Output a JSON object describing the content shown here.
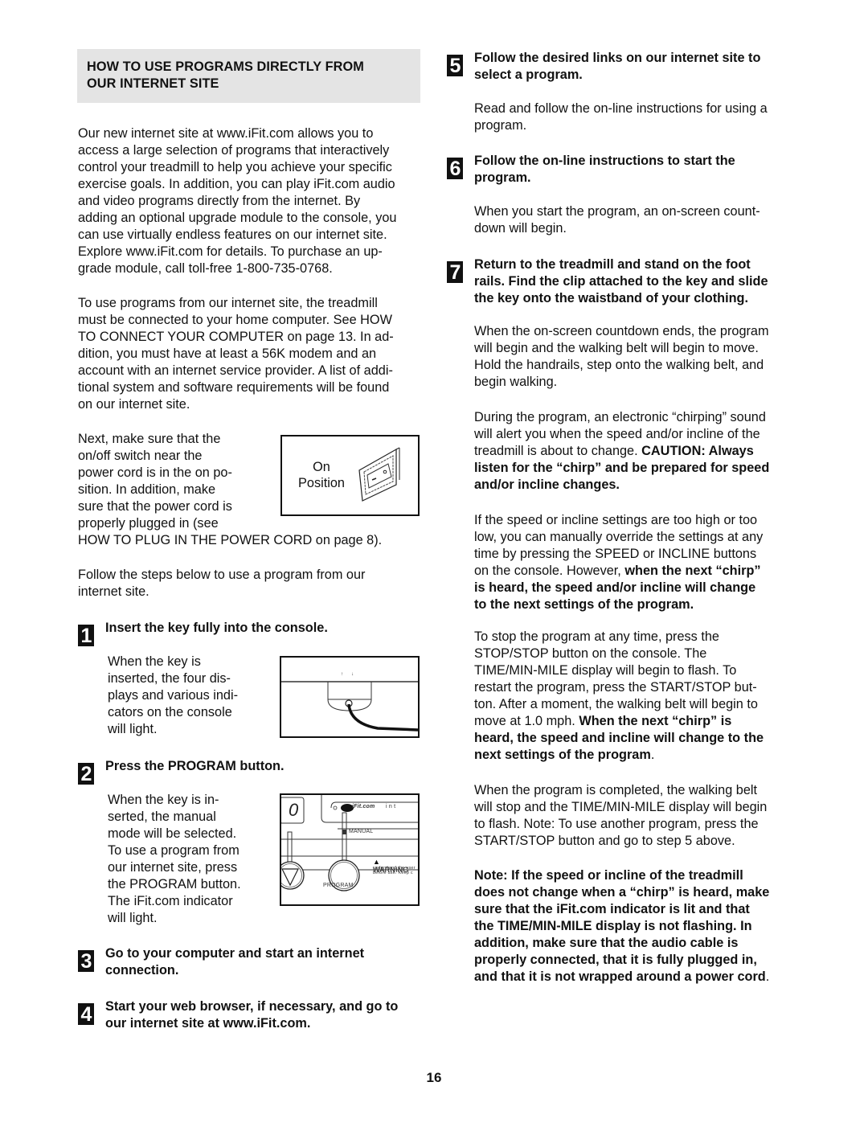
{
  "section_heading": "HOW TO USE PROGRAMS DIRECTLY FROM\nOUR INTERNET SITE",
  "left_column": {
    "intro_paragraph": "Our new internet site at www.iFit.com allows you to\naccess a large selection of programs that interactively\ncontrol your treadmill to help you achieve your specific\nexercise goals. In addition, you can play iFit.com audio\nand video programs directly from the internet. By\nadding an optional upgrade module to the console, you\ncan use virtually endless features on our internet site.\nExplore www.iFit.com for details. To purchase an up-\ngrade module, call toll-free 1-800-735-0768.",
    "requirements_paragraph": "To use programs from our internet site, the treadmill\nmust be connected to your home computer. See HOW\nTO CONNECT YOUR COMPUTER on page 13. In ad-\ndition, you must have at least a 56K modem and an\naccount with an internet service provider. A list of addi-\ntional system and software requirements will be found\non our internet site.",
    "switch_paragraph": "Next, make sure that the\non/off switch near the\npower cord is in the on po-\nsition. In addition, make\nsure that the power cord is\nproperly plugged in (see",
    "switch_paragraph_tail": "HOW TO PLUG IN THE POWER CORD on page 8).",
    "follow_steps_paragraph": "Follow the steps below to use a program from our\ninternet site.",
    "switch_figure": {
      "label": "On\nPosition"
    }
  },
  "steps": [
    {
      "number": "1",
      "title": "Insert the key fully into the console.",
      "body": "When the key is\ninserted, the four dis-\nplays and various indi-\ncators on the console\nwill light."
    },
    {
      "number": "2",
      "title": "Press the PROGRAM button.",
      "body": "When the key is in-\nserted, the manual\nmode will be selected.\nTo use a program from\nour internet site, press\nthe PROGRAM button.\nThe iFit.com indicator\nwill light."
    },
    {
      "number": "3",
      "title": "Go to your computer and start an internet\nconnection."
    },
    {
      "number": "4",
      "title": "Start your web browser, if necessary, and go to\nour internet site at www.iFit.com."
    },
    {
      "number": "5",
      "title": "Follow the desired links on our internet site to\nselect a program.",
      "body": "Read and follow the on-line instructions for using a\nprogram."
    },
    {
      "number": "6",
      "title": "Follow the on-line instructions to start the\nprogram.",
      "body": "When you start the program, an on-screen count-\ndown will begin."
    },
    {
      "number": "7",
      "title": "Return to the treadmill and stand on the foot\nrails. Find the clip attached to the key and slide\nthe key onto the waistband of your clothing.",
      "body": "When the on-screen countdown ends, the program\nwill begin and the walking belt will begin to move.\nHold the handrails, step onto the walking belt, and\nbegin walking."
    }
  ],
  "console_figure": {
    "display_digit": "0",
    "ifit_label": "iFit.com",
    "int_label": "i  n  t",
    "manual_label": "MANUAL",
    "warning_label": "▲ WARNING",
    "warning_line1": "understand the user",
    "warning_line2": "before use.  Keep c",
    "program_label": "PROGRAM"
  },
  "right_column": {
    "chirp_paragraph_plain": "During the program, an electronic “chirping” sound\nwill alert you when the speed and/or incline of the\ntreadmill is about to change. ",
    "chirp_paragraph_bold": "CAUTION: Always\nlisten for the “chirp” and be prepared for speed\nand/or incline changes.",
    "override_paragraph_plain": "If the speed or incline settings are too high or too\nlow, you can manually override the settings at any\ntime by pressing the SPEED or INCLINE buttons\non the console. However, ",
    "override_paragraph_bold": "when the next “chirp”\nis heard, the speed and/or incline will change\nto the next settings of the program.",
    "stop_paragraph_plain": "To stop the program at any time, press the\nSTOP/STOP button on the console. The\nTIME/MIN-MILE display will begin to flash. To\nrestart the program, press the START/STOP but-\nton. After a moment, the walking belt will begin to\nmove at 1.0 mph. ",
    "stop_paragraph_bold": "When the next “chirp” is\nheard, the speed and incline will change to the\nnext settings of the program",
    "stop_paragraph_end": ".",
    "completed_paragraph": "When the program is completed, the walking belt\nwill stop and the TIME/MIN-MILE display will begin\nto flash. Note: To use another program, press the\nSTART/STOP button and go to step 5 above.",
    "note_paragraph_bold": "Note: If the speed or incline of the treadmill\ndoes not change when a “chirp” is heard, make\nsure that the iFit.com indicator is lit and that\nthe TIME/MIN-MILE display is not flashing. In\naddition, make sure that the audio cable is\nproperly connected, that it is fully plugged in,\nand that it is not wrapped around a power cord",
    "note_paragraph_end": "."
  },
  "page_number": "16"
}
